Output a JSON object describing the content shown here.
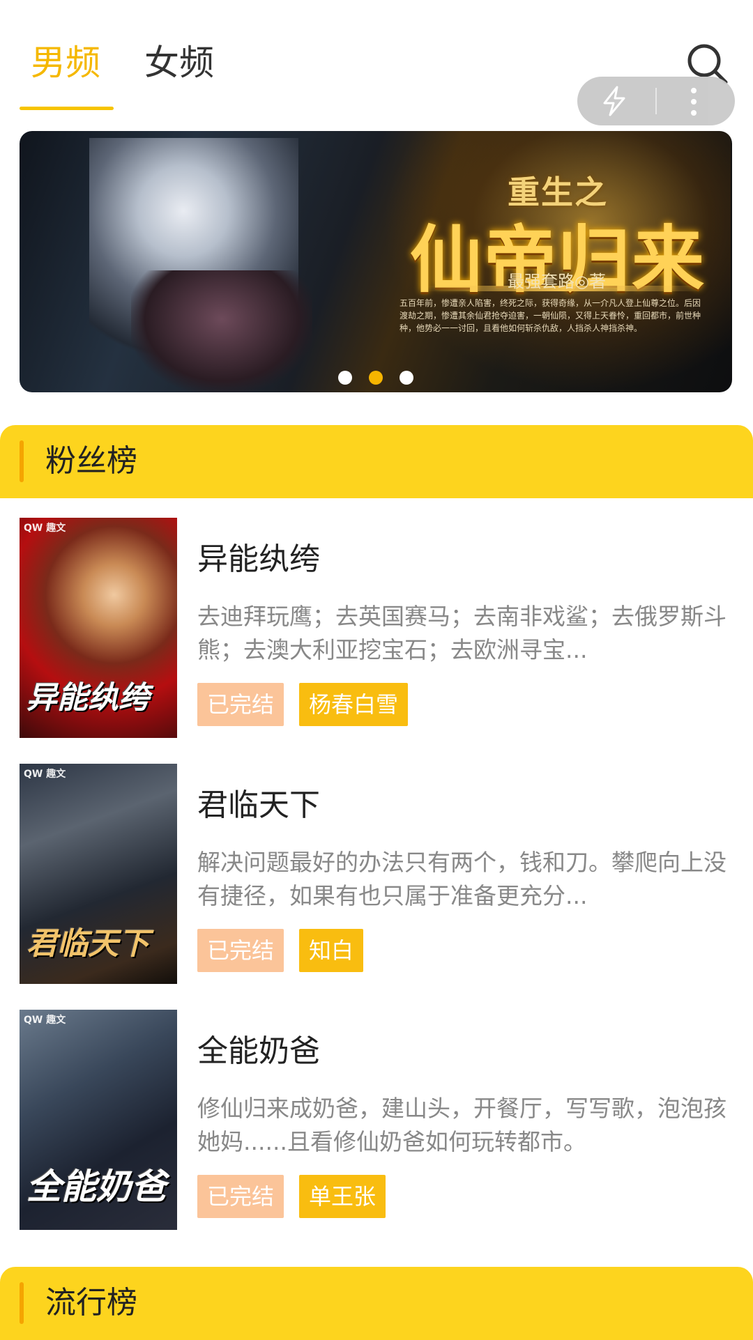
{
  "tabs": [
    {
      "label": "男频",
      "active": true
    },
    {
      "label": "女频",
      "active": false
    }
  ],
  "icons": {
    "search": "search-icon",
    "flash": "lightning-icon",
    "more": "more-vertical-icon"
  },
  "banner": {
    "subtitle": "重生之",
    "title": "仙帝归来",
    "author": "最强套路◎著",
    "blurb": "五百年前，惨遭亲人陷害，终死之际，获得奇缘，从一介凡人登上仙尊之位。后因渡劫之期，惨遭其余仙君抢夺迫害，一朝仙陨，又得上天眷怜，重回都市，前世种种，他势必一一讨回，且看他如何斩杀仇敌，人挡杀人神挡杀神。",
    "dots": 3,
    "active_dot": 1
  },
  "sections": [
    {
      "label": "粉丝榜",
      "books": [
        {
          "title": "异能纨绔",
          "cover_text": "异能纨绔",
          "cover_logo": "QW 趣文",
          "description": "去迪拜玩鹰；去英国赛马；去南非戏鲨；去俄罗斯斗熊；去澳大利亚挖宝石；去欧洲寻宝...",
          "status": "已完结",
          "author": "杨春白雪"
        },
        {
          "title": "君临天下",
          "cover_text": "君临天下",
          "cover_logo": "QW 趣文",
          "description": "解决问题最好的办法只有两个，钱和刀。攀爬向上没有捷径，如果有也只属于准备更充分...",
          "status": "已完结",
          "author": "知白"
        },
        {
          "title": "全能奶爸",
          "cover_text": "全能奶爸",
          "cover_logo": "QW 趣文",
          "description": "修仙归来成奶爸，建山头，开餐厅，写写歌，泡泡孩她妈......且看修仙奶爸如何玩转都市。",
          "status": "已完结",
          "author": "单王张"
        }
      ]
    },
    {
      "label": "流行榜",
      "books": []
    }
  ],
  "colors": {
    "accent": "#f5b800",
    "section_bg": "#fdd41e",
    "status_tag": "#fbc499",
    "author_tag": "#f9bd10"
  }
}
